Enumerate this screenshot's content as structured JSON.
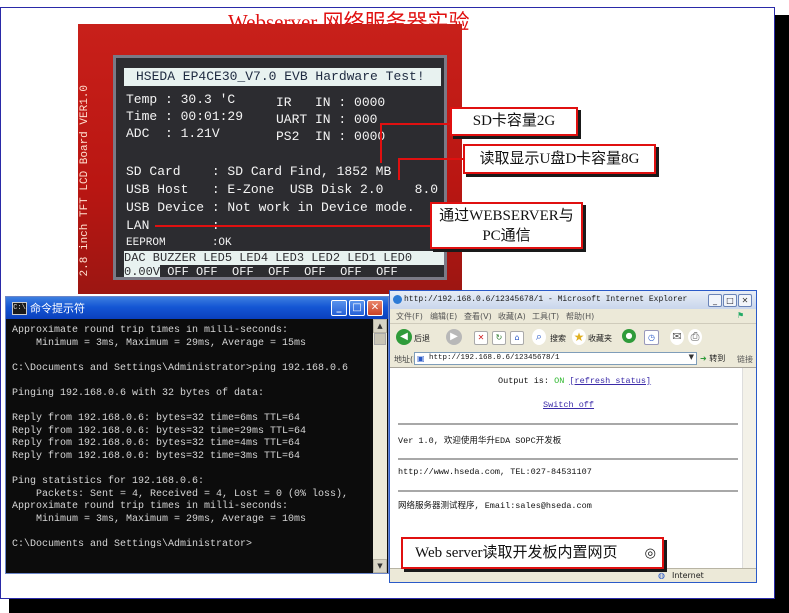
{
  "page_title": "Webserver 网络服务器实验",
  "lcd": {
    "board_label": "2.8 inch TFT LCD Board  VER1.0",
    "header": "HSEDA EP4CE30_V7.0 EVB Hardware Test!",
    "lines": [
      "Temp : 30.3 'C",
      "Time : 00:01:29",
      "ADC  : 1.21V",
      "IR   IN : 0000",
      "UART IN : 000",
      "PS2  IN : 0000",
      "SD Card    : SD Card Find, 1852 MB",
      "USB Host   : E-Zone  USB Disk 2.0    8.0",
      "USB Device : Not work in Device mode.",
      "LAN        :",
      "EEPROM       :OK"
    ],
    "dac_header": "DAC BUZZER LED5 LED4 LED3 LED2 LED1 LED0",
    "dac_values": [
      "0.00V",
      "OFF",
      "OFF",
      "OFF",
      "OFF",
      "OFF",
      "OFF",
      "OFF"
    ]
  },
  "callouts": {
    "sd": "SD卡容量2G",
    "udisk": "读取显示U盘D卡容量8G",
    "webserver_line1": "通过WEBSERVER与",
    "webserver_line2": "PC通信",
    "ie": "Web server读取开发板内置网页"
  },
  "cmd": {
    "title": "命令提示符",
    "icon_text": "C:\\",
    "lines": [
      "Approximate round trip times in milli-seconds:",
      "    Minimum = 3ms, Maximum = 29ms, Average = 15ms",
      "",
      "C:\\Documents and Settings\\Administrator>ping 192.168.0.6",
      "",
      "Pinging 192.168.0.6 with 32 bytes of data:",
      "",
      "Reply from 192.168.0.6: bytes=32 time=6ms TTL=64",
      "Reply from 192.168.0.6: bytes=32 time=29ms TTL=64",
      "Reply from 192.168.0.6: bytes=32 time=4ms TTL=64",
      "Reply from 192.168.0.6: bytes=32 time=3ms TTL=64",
      "",
      "Ping statistics for 192.168.0.6:",
      "    Packets: Sent = 4, Received = 4, Lost = 0 (0% loss),",
      "Approximate round trip times in milli-seconds:",
      "    Minimum = 3ms, Maximum = 29ms, Average = 10ms",
      "",
      "C:\\Documents and Settings\\Administrator>"
    ]
  },
  "ie": {
    "title": "http://192.168.0.6/12345678/1 - Microsoft Internet Explorer",
    "menus": [
      "文件(F)",
      "编辑(E)",
      "查看(V)",
      "收藏(A)",
      "工具(T)",
      "帮助(H)"
    ],
    "toolbar": {
      "back": "后退",
      "search": "搜索",
      "favorites": "收藏夹"
    },
    "address_label": "地址(D)",
    "address": "http://192.168.0.6/12345678/1",
    "go": "转到",
    "links": "链接",
    "output_label": "Output is: ",
    "output_state": "ON",
    "refresh": "[refresh status]",
    "switch": "Switch off",
    "version_line": "Ver 1.0, 欢迎使用华升EDA SOPC开发板",
    "website_line": "http://www.hseda.com, TEL:027-84531107",
    "email_line": "网络服务器测试程序, Email:sales@hseda.com",
    "status": "Internet"
  },
  "colors": {
    "accent_red": "#e01010",
    "on_green": "#2fb82f",
    "link_blue": "#3a2aa8",
    "xp_title_blue": "#1456d4"
  }
}
